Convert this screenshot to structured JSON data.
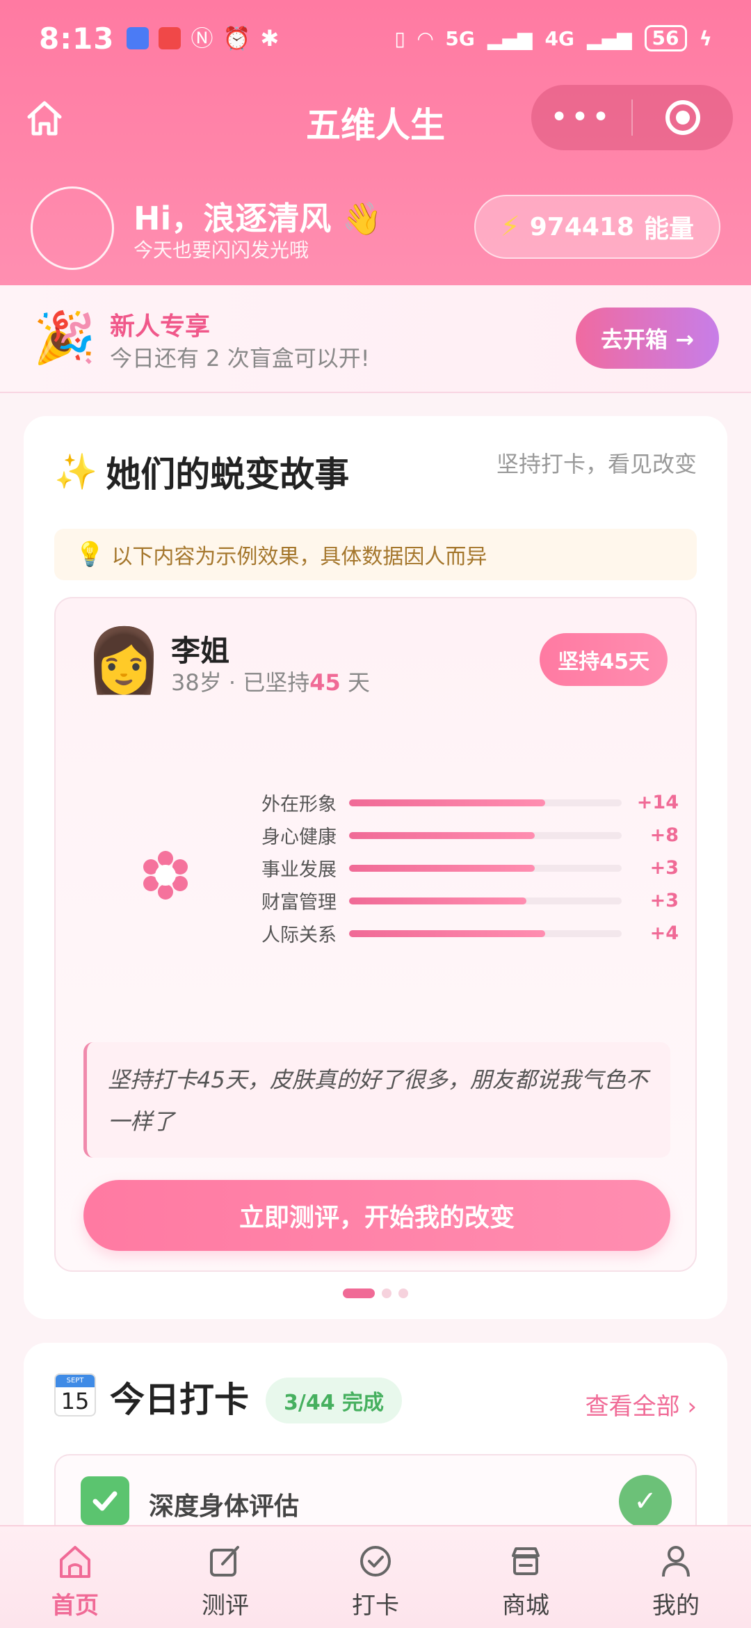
{
  "status_bar": {
    "time": "8:13",
    "network1": "5G",
    "network2": "4G",
    "battery": "56"
  },
  "nav": {
    "title": "五维人生",
    "more": "•••"
  },
  "user": {
    "greeting": "Hi，浪逐清风 👋",
    "subtitle": "今天也要闪闪发光哦",
    "energy_value": "974418",
    "energy_label": "能量"
  },
  "banner": {
    "icon": "🎉",
    "title": "新人专享",
    "subtitle": "今日还有 2 次盲盒可以开!",
    "button": "去开箱 →"
  },
  "stories": {
    "title": "她们的蜕变故事",
    "subtitle": "坚持打卡，看见改变",
    "tip": "以下内容为示例效果，具体数据因人而异",
    "person": {
      "avatar": "👩",
      "name": "李姐",
      "age": "38岁",
      "meta_prefix": "· 已坚持",
      "days": "45",
      "meta_suffix": " 天",
      "badge": "坚持45天"
    },
    "chart_data": {
      "type": "bar",
      "categories": [
        "外在形象",
        "身心健康",
        "事业发展",
        "财富管理",
        "人际关系"
      ],
      "labels": [
        "+14",
        "+8",
        "+3",
        "+3",
        "+4"
      ],
      "fill_fraction": [
        0.72,
        0.68,
        0.68,
        0.65,
        0.72
      ]
    },
    "quote": "坚持打卡45天，皮肤真的好了很多，朋友都说我气色不一样了",
    "cta": "立即测评，开始我的改变",
    "carousel_dots": 3,
    "carousel_active": 0
  },
  "checkin": {
    "cal_month": "SEPT",
    "cal_day": "15",
    "title": "今日打卡",
    "badge": "3/44 完成",
    "view_all": "查看全部 ›",
    "task_name": "深度身体评估",
    "task_done_mark": "✓"
  },
  "tabs": [
    {
      "label": "首页",
      "icon": "home-icon",
      "active": true
    },
    {
      "label": "测评",
      "icon": "edit-icon",
      "active": false
    },
    {
      "label": "打卡",
      "icon": "check-circle-icon",
      "active": false
    },
    {
      "label": "商城",
      "icon": "shop-icon",
      "active": false
    },
    {
      "label": "我的",
      "icon": "user-icon",
      "active": false
    }
  ],
  "colors": {
    "primary": "#ff7aa2",
    "accent": "#f06a96",
    "success": "#5bc46f"
  }
}
